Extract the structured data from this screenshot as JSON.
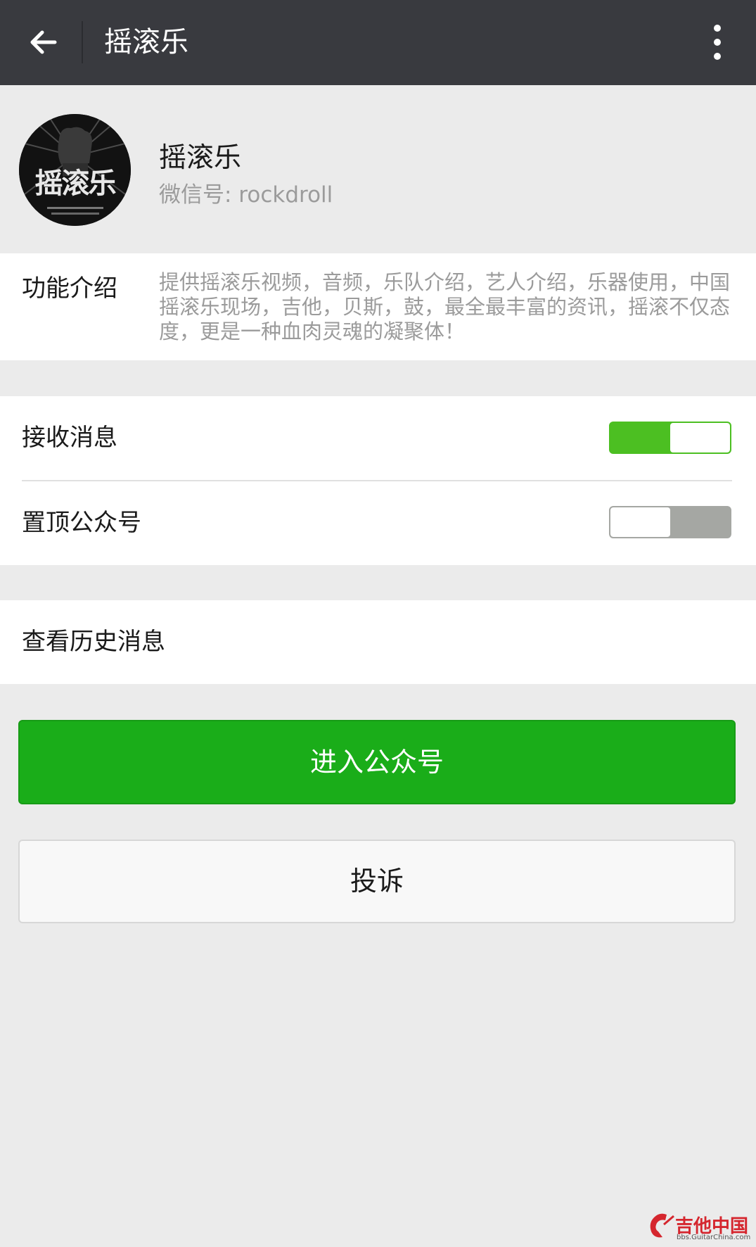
{
  "header": {
    "title": "摇滚乐",
    "back_icon": "arrow-left-icon",
    "more_icon": "more-vertical-icon"
  },
  "profile": {
    "name": "摇滚乐",
    "wechat_id": "微信号: rockdroll",
    "avatar_text": "摇滚乐"
  },
  "intro": {
    "label": "功能介绍",
    "text": "提供摇滚乐视频，音频，乐队介绍，艺人介绍，乐器使用，中国摇滚乐现场，吉他，贝斯，鼓，最全最丰富的资讯，摇滚不仅态度，更是一种血肉灵魂的凝聚体！"
  },
  "settings": [
    {
      "label": "接收消息",
      "enabled": true
    },
    {
      "label": "置顶公众号",
      "enabled": false
    }
  ],
  "history": {
    "label": "查看历史消息"
  },
  "buttons": {
    "primary": "进入公众号",
    "secondary": "投诉"
  },
  "watermark": {
    "title": "吉他中国",
    "url": "bbs.GuitarChina.com"
  },
  "colors": {
    "topbar": "#393a3f",
    "accent_green": "#1aad19",
    "toggle_on": "#4cbf22",
    "toggle_off": "#a5a7a3",
    "background": "#ebebeb"
  }
}
